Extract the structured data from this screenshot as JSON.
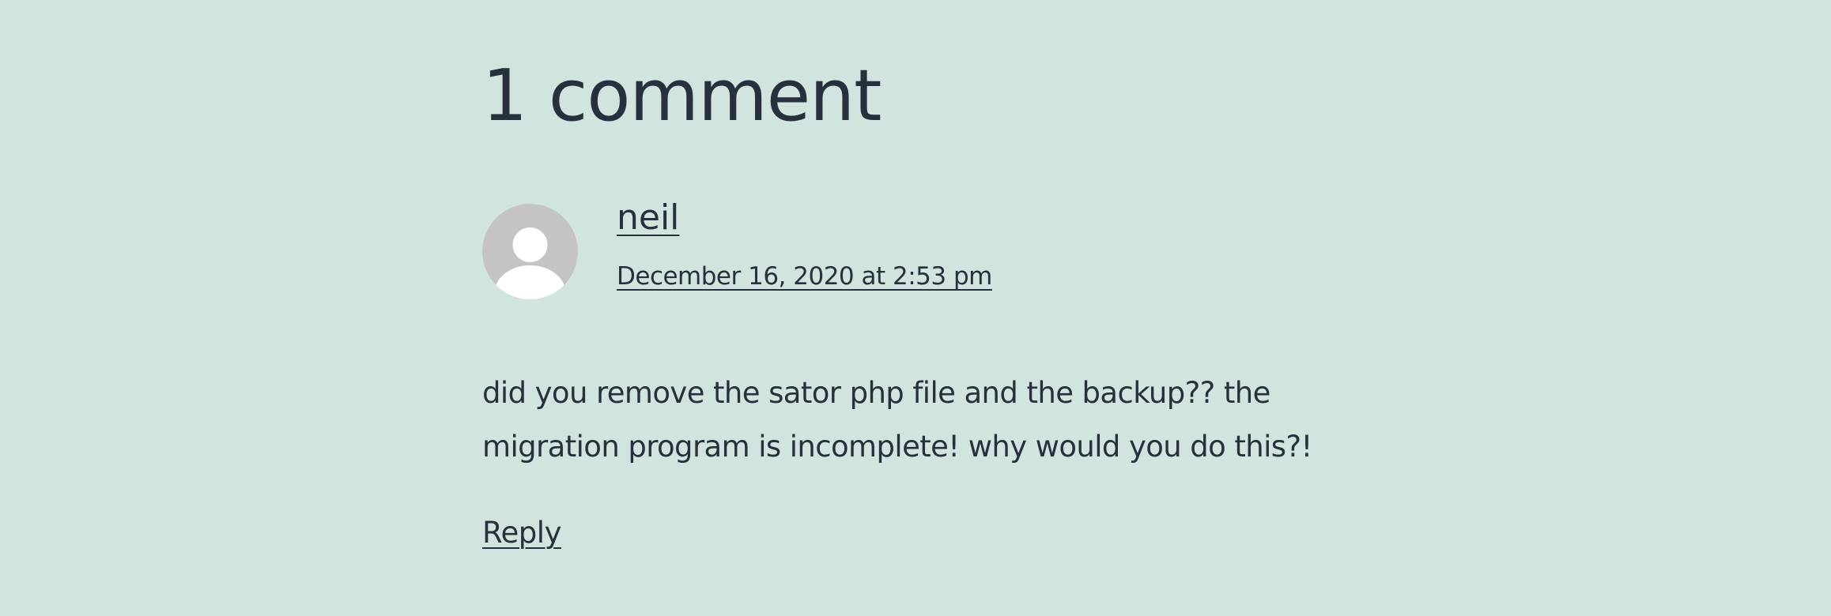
{
  "comments": {
    "title": "1 comment",
    "items": [
      {
        "author": "neil",
        "avatar_icon": "default-user-avatar-icon",
        "date": "December 16, 2020 at 2:53 pm",
        "content": "did you remove the sator php file and the backup?? the migration program is incomplete! why would you do this?!",
        "reply_label": "Reply"
      }
    ]
  },
  "colors": {
    "background": "#d1e4dd",
    "text": "#28303d",
    "avatar_bg": "#c4c4c4",
    "avatar_figure": "#ffffff"
  }
}
